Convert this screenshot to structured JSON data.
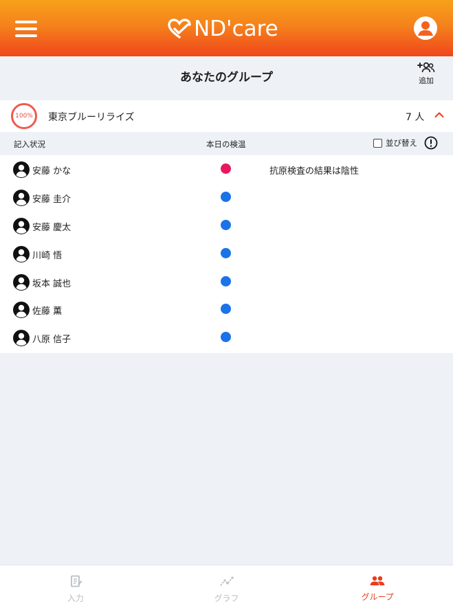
{
  "header": {
    "logo_text": "ND'care",
    "menu_icon": "hamburger-menu-icon",
    "account_icon": "account-circle-icon"
  },
  "titlebar": {
    "title": "あなたのグループ",
    "add_label": "追加",
    "add_icon": "person-add-icon"
  },
  "group": {
    "progress": "100%",
    "name": "東京ブルーリライズ",
    "member_count": "7 人"
  },
  "columns": {
    "status": "記入状況",
    "temperature": "本日の検温",
    "sort": "並び替え"
  },
  "members": [
    {
      "name": "安藤 かな",
      "status_color": "#e8185f",
      "note": "抗原検査の結果は陰性"
    },
    {
      "name": "安藤 圭介",
      "status_color": "#1a73e8",
      "note": ""
    },
    {
      "name": "安藤 慶太",
      "status_color": "#1a73e8",
      "note": ""
    },
    {
      "name": "川崎 悟",
      "status_color": "#1a73e8",
      "note": ""
    },
    {
      "name": "坂本 誠也",
      "status_color": "#1a73e8",
      "note": ""
    },
    {
      "name": "佐藤 薫",
      "status_color": "#1a73e8",
      "note": ""
    },
    {
      "name": "八原 信子",
      "status_color": "#1a73e8",
      "note": ""
    }
  ],
  "bottom_nav": [
    {
      "label": "入力",
      "icon": "input-document-icon",
      "active": false
    },
    {
      "label": "グラフ",
      "icon": "graph-icon",
      "active": false
    },
    {
      "label": "グループ",
      "icon": "group-people-icon",
      "active": true
    }
  ],
  "colors": {
    "header_start": "#f6a11a",
    "header_end": "#f0461c",
    "accent": "#ea3c1c",
    "dot_alert": "#e8185f",
    "dot_normal": "#1a73e8"
  }
}
